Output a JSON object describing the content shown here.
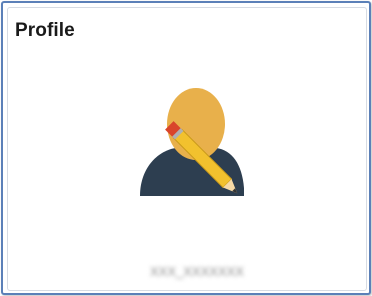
{
  "tile": {
    "title": "Profile",
    "username": "XXX_XXXXXXX",
    "icon": "profile-edit-icon"
  },
  "colors": {
    "frame_border": "#5b80b8",
    "head": "#e8b04b",
    "body": "#2d3e50",
    "pencil": "#f2c12e",
    "pencil_tip": "#d9452b"
  }
}
